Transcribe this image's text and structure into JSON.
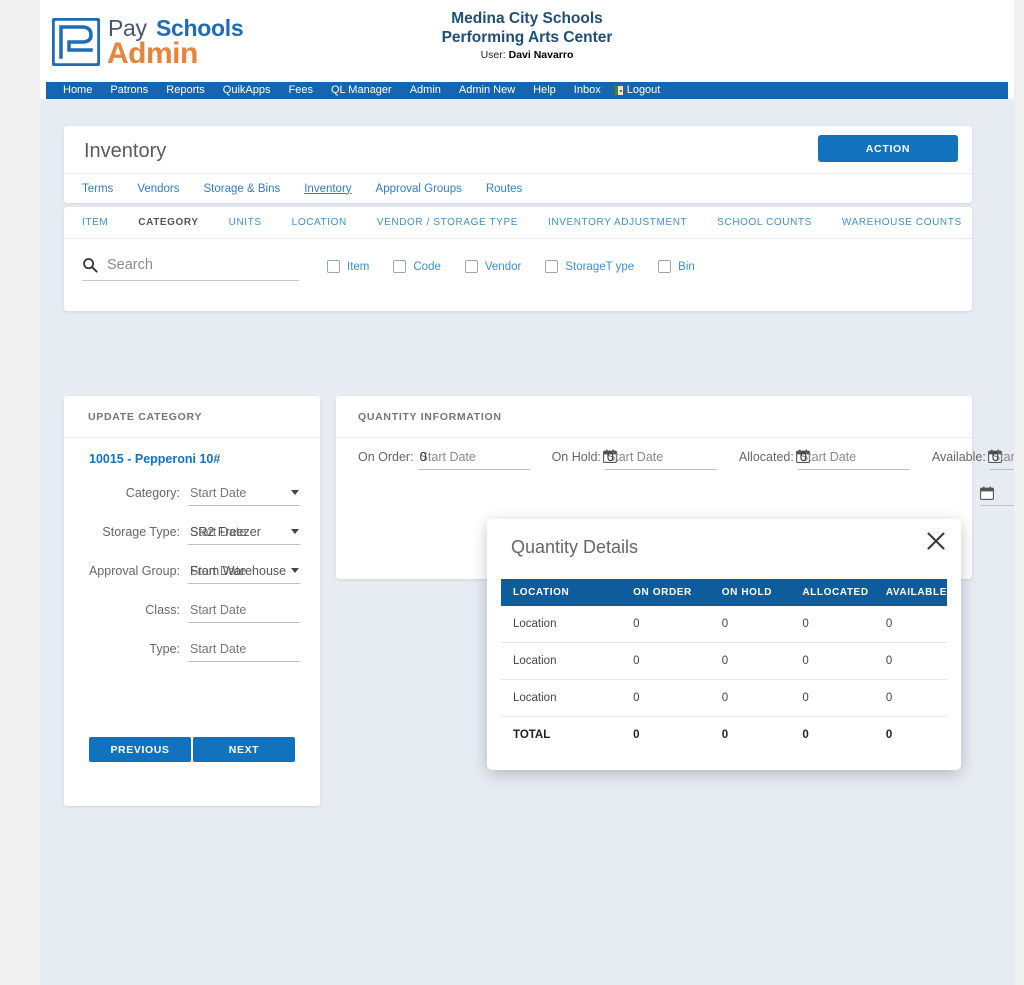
{
  "brand": {
    "pay": "Pay",
    "schools": "Schools",
    "admin": "Admin",
    "accent_blue": "#1e6bb8",
    "accent_orange": "#e8833a"
  },
  "org": {
    "line1": "Medina City Schools",
    "line2": "Performing Arts Center",
    "user_label": "User:",
    "user_name": "Davi Navarro"
  },
  "navbar": {
    "items": [
      {
        "label": "Home",
        "icon": ""
      },
      {
        "label": "Patrons",
        "icon": ""
      },
      {
        "label": "Reports",
        "icon": ""
      },
      {
        "label": "QuikApps",
        "icon": ""
      },
      {
        "label": "Fees",
        "icon": ""
      },
      {
        "label": "QL Manager",
        "icon": ""
      },
      {
        "label": "Admin",
        "icon": ""
      },
      {
        "label": "Admin New",
        "icon": ""
      },
      {
        "label": "Help",
        "icon": ""
      },
      {
        "label": "Inbox",
        "icon": ""
      },
      {
        "label": "Logout",
        "icon": "door-exit-icon"
      }
    ]
  },
  "page": {
    "title": "Inventory",
    "action_button": "ACTION"
  },
  "subnav": {
    "items": [
      {
        "label": "Terms",
        "active": false
      },
      {
        "label": "Vendors",
        "active": false
      },
      {
        "label": "Storage & Bins",
        "active": false
      },
      {
        "label": "Inventory",
        "active": true
      },
      {
        "label": "Approval Groups",
        "active": false
      },
      {
        "label": "Routes",
        "active": false
      }
    ]
  },
  "tabs": [
    {
      "label": "ITEM",
      "active": false
    },
    {
      "label": "CATEGORY",
      "active": true
    },
    {
      "label": "UNITS",
      "active": false
    },
    {
      "label": "LOCATION",
      "active": false
    },
    {
      "label": "VENDOR / STORAGE TYPE",
      "active": false
    },
    {
      "label": "INVENTORY ADJUSTMENT",
      "active": false
    },
    {
      "label": "SCHOOL COUNTS",
      "active": false
    },
    {
      "label": "WAREHOUSE COUNTS",
      "active": false
    }
  ],
  "search": {
    "placeholder": "Search",
    "value": "",
    "icon": "search-icon",
    "filters": [
      {
        "label": "Item",
        "checked": false
      },
      {
        "label": "Code",
        "checked": false
      },
      {
        "label": "Vendor",
        "checked": false
      },
      {
        "label": "StorageT ype",
        "checked": false
      },
      {
        "label": "Bin",
        "checked": false
      }
    ]
  },
  "update_category": {
    "header": "UPDATE CATEGORY",
    "item_name": "10015 - Pepperoni 10#",
    "fields": [
      {
        "label": "Category:",
        "placeholder": "Start Date",
        "value": "",
        "dropdown": true
      },
      {
        "label": "Storage Type:",
        "placeholder": "Start Date",
        "value": "SR2 Freezer",
        "dropdown": true
      },
      {
        "label": "Approval Group:",
        "placeholder": "Start Date",
        "value": "From Warehouse",
        "dropdown": true
      },
      {
        "label": "Class:",
        "placeholder": "Start Date",
        "value": "",
        "dropdown": false
      },
      {
        "label": "Type:",
        "placeholder": "Start Date",
        "value": "",
        "dropdown": false
      }
    ],
    "previous_button": "PREVIOUS",
    "next_button": "NEXT"
  },
  "quantity_information": {
    "header": "QUANTITY INFORMATION",
    "fields": [
      {
        "label": "On Order:",
        "placeholder": "Start Date",
        "value": "0",
        "calendar_icon": false
      },
      {
        "label": "On Hold:",
        "placeholder": "Start Date",
        "value": "0",
        "calendar_icon": true
      },
      {
        "label": "Allocated:",
        "placeholder": "Start Date",
        "value": "0",
        "calendar_icon": true
      },
      {
        "label": "Available:",
        "placeholder": "Start Date",
        "value": "0",
        "calendar_icon": true
      }
    ],
    "action_button": ""
  },
  "modal": {
    "title": "Quantity Details",
    "close_icon": "close-icon",
    "columns": [
      "LOCATION",
      "ON ORDER",
      "ON HOLD",
      "ALLOCATED",
      "AVAILABLE"
    ],
    "rows": [
      {
        "location": "Location",
        "on_order": "0",
        "on_hold": "0",
        "allocated": "0",
        "available": "0"
      },
      {
        "location": "Location",
        "on_order": "0",
        "on_hold": "0",
        "allocated": "0",
        "available": "0"
      },
      {
        "location": "Location",
        "on_order": "0",
        "on_hold": "0",
        "allocated": "0",
        "available": "0"
      }
    ],
    "total": {
      "location": "TOTAL",
      "on_order": "0",
      "on_hold": "0",
      "allocated": "0",
      "available": "0"
    }
  },
  "colors": {
    "nav_blue": "#1565b0",
    "primary_blue": "#1272bd",
    "table_header_blue": "#0f5c9c",
    "app_bg": "#e7ecf3",
    "link_blue": "#3e90cf"
  }
}
